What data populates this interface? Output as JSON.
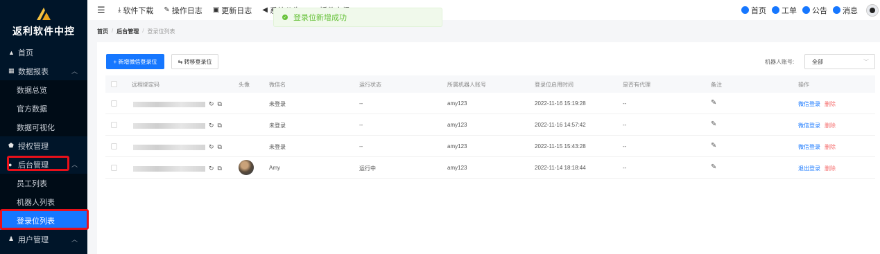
{
  "app": {
    "logo_text": "返利软件中控"
  },
  "sidebar": {
    "items": [
      {
        "label": "首页",
        "icon": "home-icon"
      },
      {
        "label": "数据报表",
        "icon": "chart-icon"
      },
      {
        "label": "数据总览"
      },
      {
        "label": "官方数据"
      },
      {
        "label": "数据可视化"
      },
      {
        "label": "授权管理",
        "icon": "shield-icon"
      },
      {
        "label": "后台管理",
        "icon": "admin-icon"
      },
      {
        "label": "员工列表"
      },
      {
        "label": "机器人列表"
      },
      {
        "label": "登录位列表"
      },
      {
        "label": "用户管理",
        "icon": "users-icon"
      }
    ]
  },
  "topbar": {
    "nav": [
      {
        "label": "软件下载",
        "icon": "download-icon"
      },
      {
        "label": "操作日志",
        "icon": "log-icon"
      },
      {
        "label": "更新日志",
        "icon": "update-icon"
      },
      {
        "label": "系统公告",
        "icon": "announce-icon"
      },
      {
        "label": "插件市场",
        "icon": "market-icon"
      }
    ],
    "right": [
      {
        "label": "首页"
      },
      {
        "label": "工单"
      },
      {
        "label": "公告"
      },
      {
        "label": "消息"
      }
    ]
  },
  "toast": {
    "message": "登录位新增成功"
  },
  "breadcrumb": {
    "items": [
      "首页",
      "后台管理",
      "登录位列表"
    ]
  },
  "toolbar": {
    "add_label": "+ 新增微信登录位",
    "transfer_label": "⇆ 转移登录位",
    "filter_label": "机器人账号:",
    "filter_value": "全部"
  },
  "table": {
    "headers": [
      "远程绑定码",
      "头像",
      "微信名",
      "运行状态",
      "所属机器人账号",
      "登录位启用时间",
      "是否有代理",
      "备注",
      "操作"
    ],
    "rows": [
      {
        "wechat_name": "未登录",
        "status": "--",
        "robot": "amy123",
        "time": "2022-11-16 15:19:28",
        "proxy": "--",
        "action1": "微信登录",
        "action2": "删除",
        "has_avatar": false
      },
      {
        "wechat_name": "未登录",
        "status": "--",
        "robot": "amy123",
        "time": "2022-11-16 14:57:42",
        "proxy": "--",
        "action1": "微信登录",
        "action2": "删除",
        "has_avatar": false
      },
      {
        "wechat_name": "未登录",
        "status": "--",
        "robot": "amy123",
        "time": "2022-11-15 15:43:28",
        "proxy": "--",
        "action1": "微信登录",
        "action2": "删除",
        "has_avatar": false
      },
      {
        "wechat_name": "Amy",
        "status": "运行中",
        "robot": "amy123",
        "time": "2022-11-14 18:18:44",
        "proxy": "--",
        "action1": "退出登录",
        "action2": "删除",
        "has_avatar": true
      }
    ]
  },
  "colors": {
    "primary": "#1677ff",
    "sidebar_bg": "#001529",
    "highlight_box": "#e8101a",
    "success": "#67c23a",
    "danger": "#f56c6c"
  }
}
